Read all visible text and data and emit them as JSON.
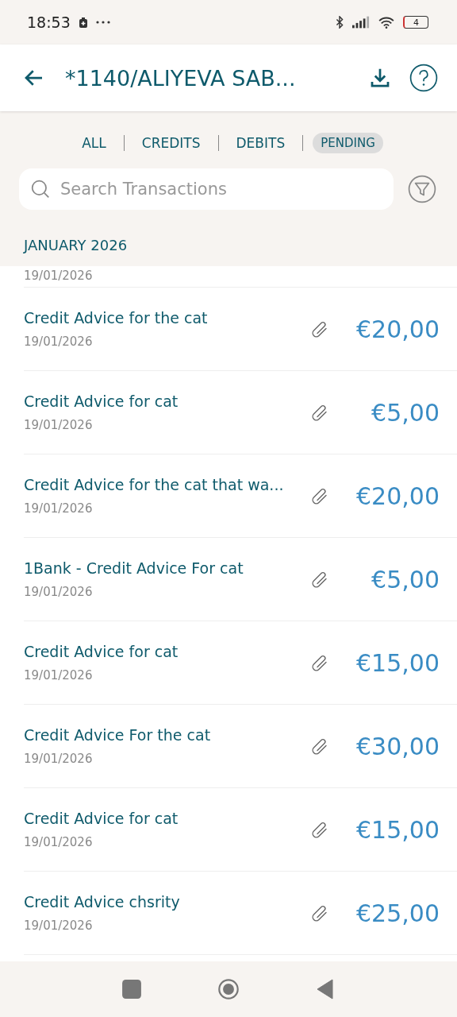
{
  "status_bar": {
    "time": "18:53",
    "battery": "4"
  },
  "app_bar": {
    "title": "*1140/ALIYEVA SAB..."
  },
  "tabs": [
    {
      "label": "ALL",
      "selected": false
    },
    {
      "label": "CREDITS",
      "selected": false
    },
    {
      "label": "DEBITS",
      "selected": false
    },
    {
      "label": "PENDING",
      "selected": true
    }
  ],
  "search": {
    "placeholder": "Search Transactions"
  },
  "section": {
    "heading": "JANUARY 2026"
  },
  "transactions": [
    {
      "kind": "date_only",
      "date": "19/01/2026"
    },
    {
      "title": "Credit Advice for the cat",
      "date": "19/01/2026",
      "amount": "€20,00",
      "attachment": true
    },
    {
      "title": "Credit Advice for cat",
      "date": "19/01/2026",
      "amount": "€5,00",
      "attachment": true
    },
    {
      "title": "Credit Advice for the cat that wa...",
      "date": "19/01/2026",
      "amount": "€20,00",
      "attachment": true
    },
    {
      "title": "1Bank - Credit Advice For cat",
      "date": "19/01/2026",
      "amount": "€5,00",
      "attachment": true
    },
    {
      "title": "Credit Advice for cat",
      "date": "19/01/2026",
      "amount": "€15,00",
      "attachment": true
    },
    {
      "title": "Credit Advice For the cat",
      "date": "19/01/2026",
      "amount": "€30,00",
      "attachment": true
    },
    {
      "title": "Credit Advice for cat",
      "date": "19/01/2026",
      "amount": "€15,00",
      "attachment": true
    },
    {
      "title": "Credit Advice chsrity",
      "date": "19/01/2026",
      "amount": "€25,00",
      "attachment": true
    }
  ]
}
